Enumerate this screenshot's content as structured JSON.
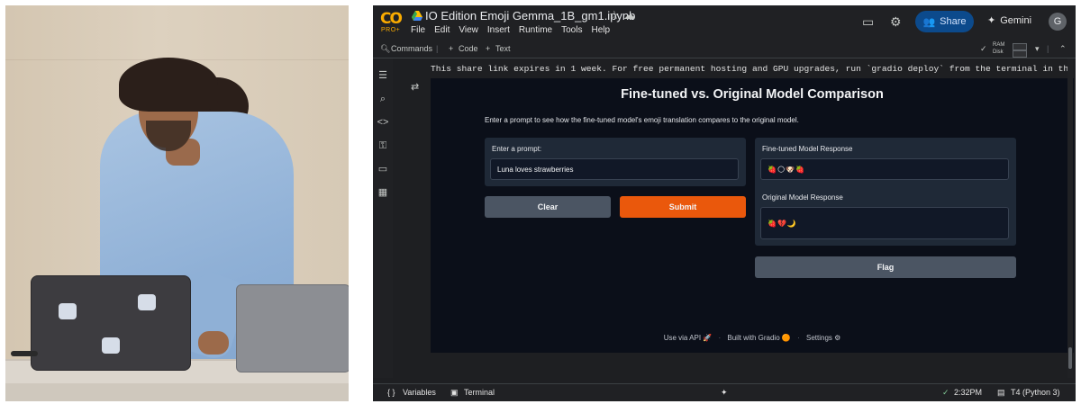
{
  "colab": {
    "logo_text": "CO",
    "logo_badge": "PRO+",
    "notebook_title": "IO Edition Emoji Gemma_1B_gm1.ipynb",
    "menus": [
      "File",
      "Edit",
      "View",
      "Insert",
      "Runtime",
      "Tools",
      "Help"
    ],
    "share_label": "Share",
    "gemini_label": "Gemini",
    "avatar_letter": "G",
    "toolbar": {
      "commands_label": "Commands",
      "code_label": "Code",
      "text_label": "Text",
      "ram_label": "RAM",
      "disk_label": "Disk"
    },
    "share_link_text": "This share link expires in 1 week. For free permanent hosting and GPU upgrades, run `gradio deploy` from the terminal in the working dire",
    "statusbar": {
      "variables_label": "Variables",
      "terminal_label": "Terminal",
      "time": "2:32PM",
      "runtime": "T4 (Python 3)"
    },
    "colors": {
      "accent_orange": "#ea580c",
      "share_blue": "#0c4a8c",
      "gradio_bg": "#0b0f19",
      "colab_bg": "#1e1f22"
    }
  },
  "gradio": {
    "title": "Fine-tuned vs. Original Model Comparison",
    "description": "Enter a prompt to see how the fine-tuned model's emoji translation compares to the original model.",
    "prompt_label": "Enter a prompt:",
    "prompt_value": "Luna loves strawberries",
    "clear_label": "Clear",
    "submit_label": "Submit",
    "finetuned_label": "Fine-tuned Model Response",
    "finetuned_value": "🍓🌕🐶🍓",
    "original_label": "Original Model Response",
    "original_value": "🍓💔🌙",
    "flag_label": "Flag",
    "footer": {
      "api_label": "Use via API",
      "gradio_label": "Built with Gradio",
      "settings_label": "Settings"
    }
  }
}
